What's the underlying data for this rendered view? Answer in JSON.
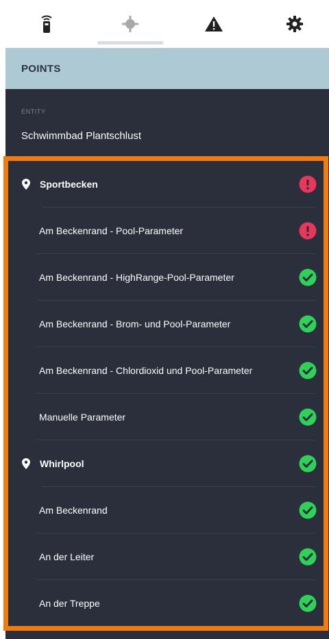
{
  "tabs": [
    {
      "icon": "remote-device-icon",
      "active": false
    },
    {
      "icon": "crosshair-points-icon",
      "active": true
    },
    {
      "icon": "warning-icon",
      "active": false
    },
    {
      "icon": "gear-icon",
      "active": false
    }
  ],
  "section": {
    "title": "POINTS"
  },
  "entity": {
    "label": "ENTITY",
    "value": "Schwimmbad Plantschlust"
  },
  "colors": {
    "ok": "#2fd158",
    "error": "#e8375a",
    "highlight": "#f07b11"
  },
  "points": [
    {
      "label": "Sportbecken",
      "type": "group",
      "status": "error"
    },
    {
      "label": "Am Beckenrand - Pool-Parameter",
      "type": "child",
      "status": "error"
    },
    {
      "label": "Am Beckenrand - HighRange-Pool-Parameter",
      "type": "child",
      "status": "ok"
    },
    {
      "label": "Am Beckenrand - Brom- und Pool-Parameter",
      "type": "child",
      "status": "ok"
    },
    {
      "label": "Am Beckenrand - Chlordioxid und Pool-Parameter",
      "type": "child",
      "status": "ok"
    },
    {
      "label": "Manuelle Parameter",
      "type": "child",
      "status": "ok"
    },
    {
      "label": "Whirlpool",
      "type": "group",
      "status": "ok"
    },
    {
      "label": "Am Beckenrand",
      "type": "child",
      "status": "ok"
    },
    {
      "label": "An der Leiter",
      "type": "child",
      "status": "ok"
    },
    {
      "label": "An der Treppe",
      "type": "child",
      "status": "ok"
    }
  ]
}
